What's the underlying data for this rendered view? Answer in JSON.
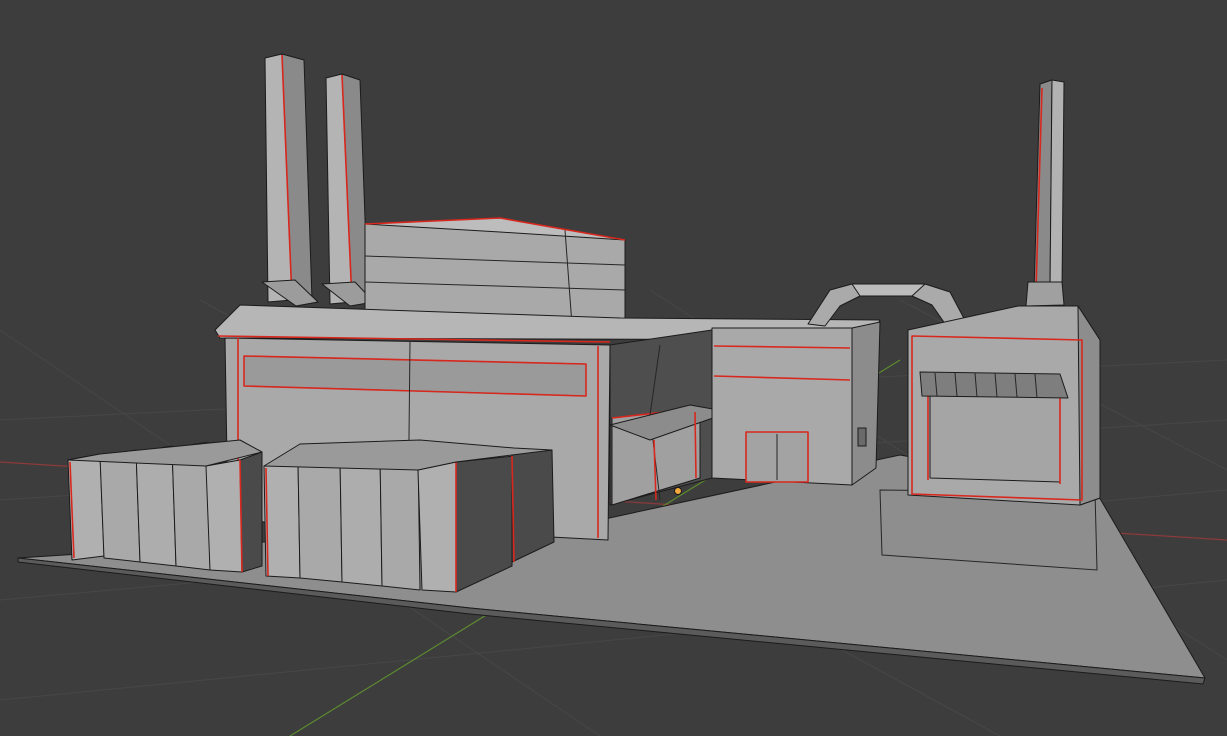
{
  "viewport": {
    "mode": "3d-viewport-solid",
    "background_color": "#3d3d3d",
    "colors": {
      "grid_line": "#474747",
      "x_axis": "#8c3a3a",
      "y_axis": "#5c8a2e",
      "mesh_light": "#a9a9a9",
      "mesh_mid": "#8f8f8f",
      "mesh_dark": "#4a4a4a",
      "seam": "#d8281e",
      "origin": "#f2a93b"
    }
  },
  "scene": {
    "object": "factory",
    "origin_marker": "object-origin-icon",
    "icons": [
      "object-origin-icon"
    ]
  }
}
